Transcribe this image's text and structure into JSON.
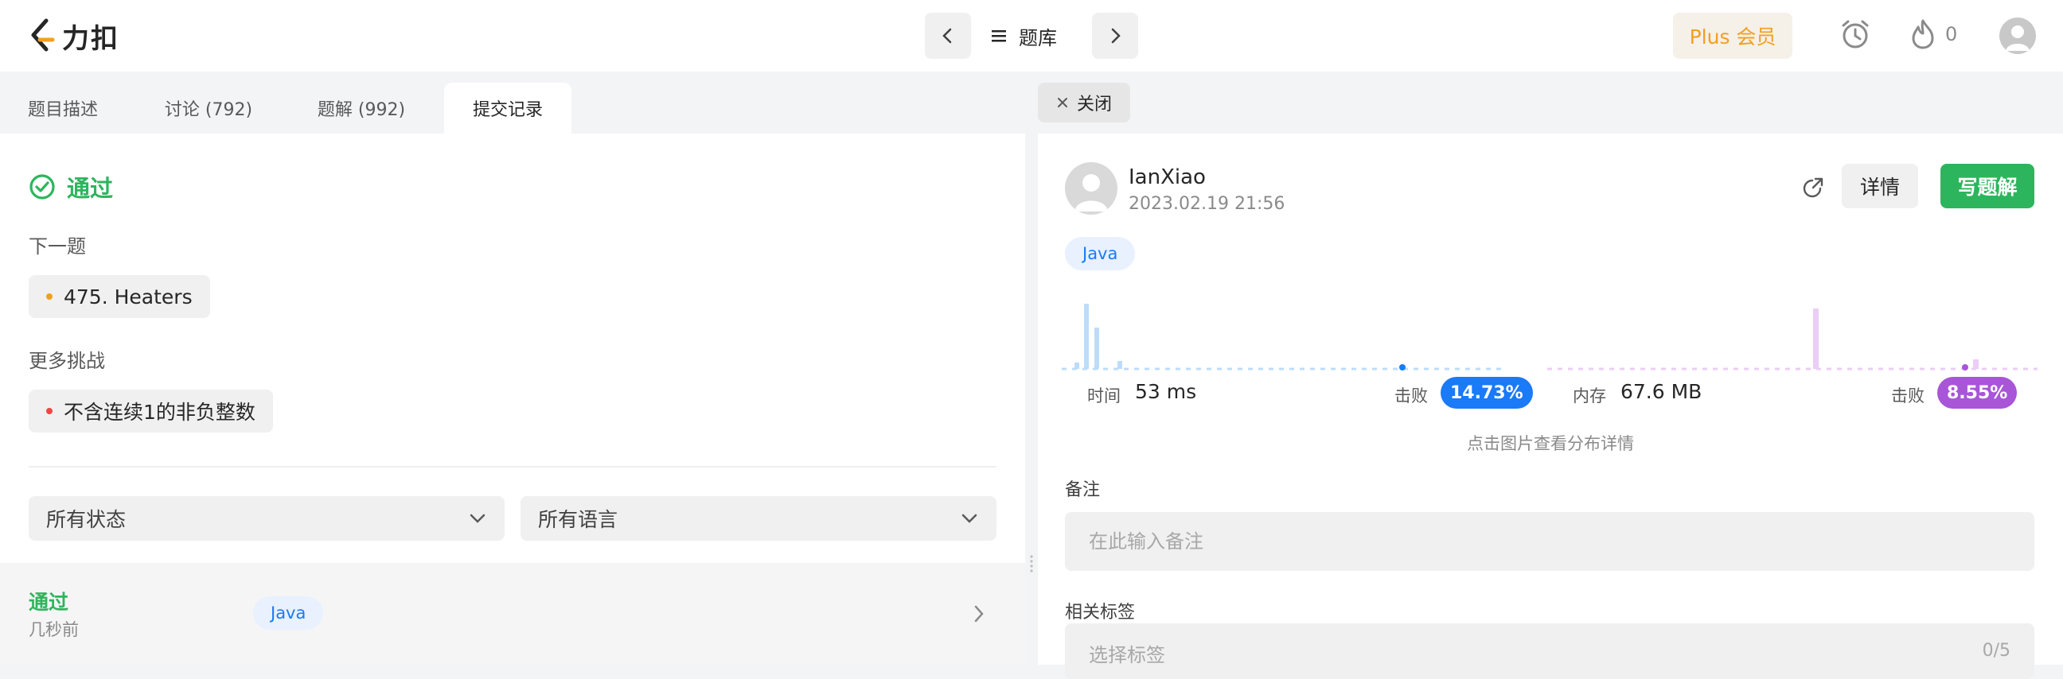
{
  "header": {
    "logo_text": "力扣",
    "problem_bank_label": "题库",
    "plus_label": "Plus 会员",
    "streak_count": "0"
  },
  "left": {
    "tabs": [
      {
        "label": "题目描述"
      },
      {
        "label": "讨论 (792)"
      },
      {
        "label": "题解 (992)"
      },
      {
        "label": "提交记录"
      }
    ],
    "status": "通过",
    "next_label": "下一题",
    "next_problem": "475. Heaters",
    "more_label": "更多挑战",
    "more_problem": "不含连续1的非负整数",
    "filter_status": "所有状态",
    "filter_lang": "所有语言",
    "submission": {
      "status": "通过",
      "time": "几秒前",
      "lang": "Java"
    }
  },
  "right": {
    "close_label": "关闭",
    "username": "IanXiao",
    "date": "2023.02.19 21:56",
    "detail_label": "详情",
    "write_label": "写题解",
    "lang": "Java",
    "time_label": "时间",
    "time_value": "53 ms",
    "beat_label": "击败",
    "time_beat": "14.73%",
    "mem_label": "内存",
    "mem_value": "67.6 MB",
    "mem_beat": "8.55%",
    "chart_hint": "点击图片查看分布详情",
    "note_label": "备注",
    "note_placeholder": "在此输入备注",
    "tags_label": "相关标签",
    "tags_placeholder": "选择标签",
    "tags_count": "0/5"
  },
  "colors": {
    "accent_green": "#2db55d",
    "accent_blue": "#1a7af8",
    "accent_purple": "#a855d8",
    "plus_orange": "#f0a020"
  }
}
